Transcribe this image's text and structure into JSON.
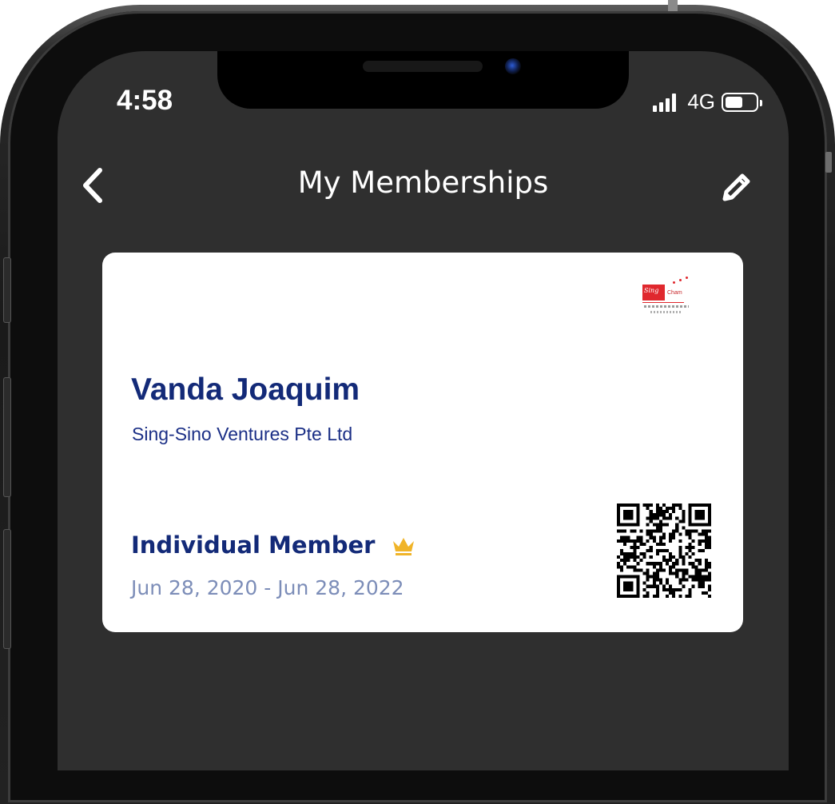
{
  "status_bar": {
    "time": "4:58",
    "network": "4G"
  },
  "header": {
    "title": "My Memberships"
  },
  "card": {
    "name": "Vanda Joaquim",
    "company": "Sing-Sino Ventures Pte Ltd",
    "membership_type": "Individual Member",
    "validity": "Jun 28, 2020 - Jun 28, 2022",
    "brand_logo_text": "Sing Cham",
    "icons": {
      "crown": "crown-icon",
      "qr": "qr-code"
    }
  },
  "colors": {
    "screen_bg": "#2f2f2f",
    "name": "#132a78",
    "dates": "#7c8db8",
    "crown": "#f0b429"
  }
}
